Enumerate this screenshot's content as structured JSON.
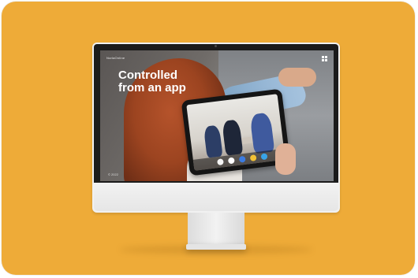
{
  "screen": {
    "brand": "NorlaOnline",
    "headline_line1": "Controlled",
    "headline_line2": "from an app",
    "footer": "© 2022"
  },
  "colors": {
    "background": "#eeab38",
    "monitor": "#f1f1f1",
    "bezel": "#1b1b1b",
    "headline": "#ffffff"
  },
  "icons": {
    "corner": "grid-icon"
  }
}
